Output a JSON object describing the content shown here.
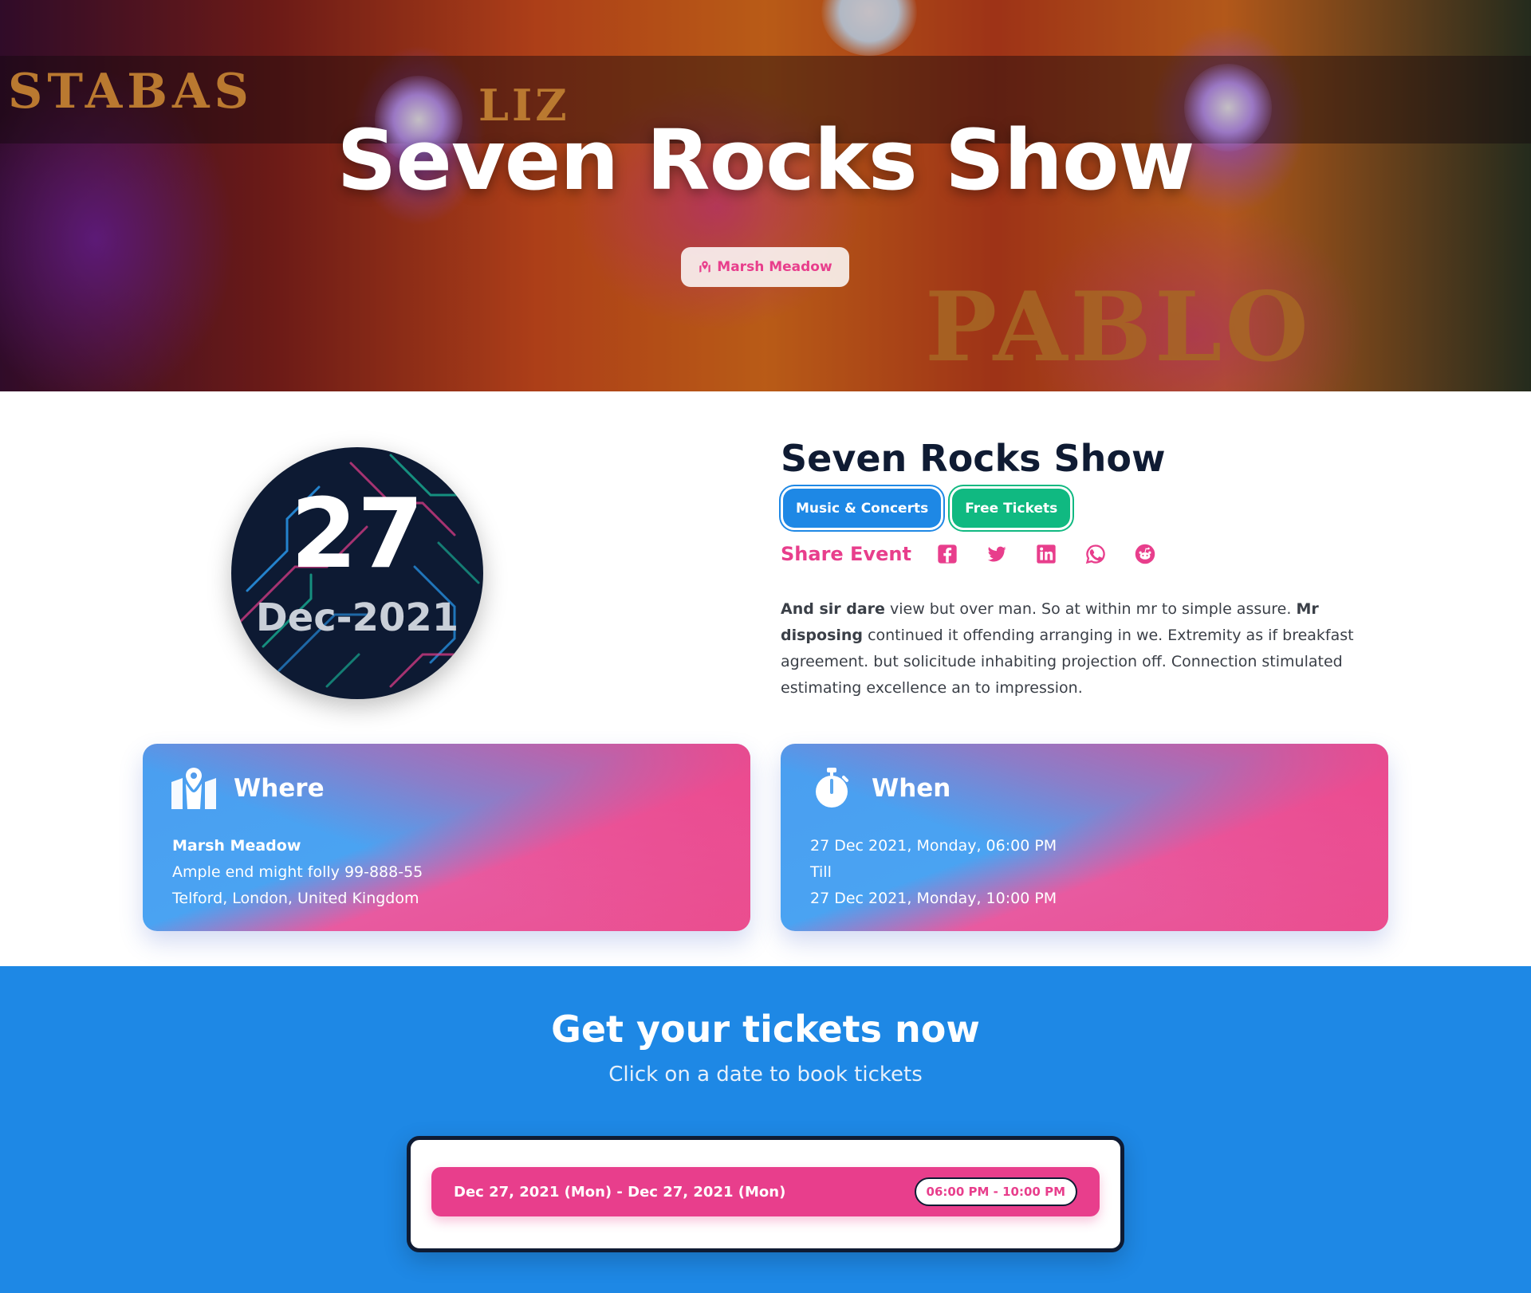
{
  "hero": {
    "title": "Seven Rocks Show",
    "venue_badge": "Marsh Meadow",
    "background_sign_left": "STABAS",
    "background_sign_mid": "LIZ",
    "background_sign_right": "PABLO"
  },
  "date_badge": {
    "day": "27",
    "month_year": "Dec-2021"
  },
  "event": {
    "title": "Seven Rocks Show",
    "tags": [
      {
        "label": "Music & Concerts",
        "color": "#1e88e5"
      },
      {
        "label": "Free Tickets",
        "color": "#10b981"
      }
    ],
    "share_label": "Share Event",
    "share_icons": [
      "facebook-icon",
      "twitter-icon",
      "linkedin-icon",
      "whatsapp-icon",
      "reddit-icon"
    ],
    "description": {
      "part1_bold": "And sir dare",
      "part2": " view but over man. So at within mr to simple assure. ",
      "part3_bold": "Mr disposing",
      "part4": " continued it offending arranging in we. Extremity as if breakfast agreement. but solicitude inhabiting projection off. Connection stimulated estimating excellence an to impression."
    }
  },
  "where": {
    "title": "Where",
    "venue": "Marsh Meadow",
    "address_line1": "Ample end might folly 99-888-55",
    "address_line2": "Telford, London, United Kingdom"
  },
  "when": {
    "title": "When",
    "start": "27 Dec 2021, Monday, 06:00 PM",
    "till": "Till",
    "end": "27 Dec 2021, Monday, 10:00 PM"
  },
  "tickets": {
    "title": "Get your tickets now",
    "subtitle": "Click on a date to book tickets",
    "slots": [
      {
        "date_range": "Dec 27, 2021 (Mon) - Dec 27, 2021 (Mon)",
        "time_range": "06:00 PM - 10:00 PM"
      }
    ]
  },
  "colors": {
    "accent_pink": "#e83e8c",
    "primary_blue": "#1e88e5",
    "success_green": "#10b981",
    "navy": "#0f1b33"
  }
}
